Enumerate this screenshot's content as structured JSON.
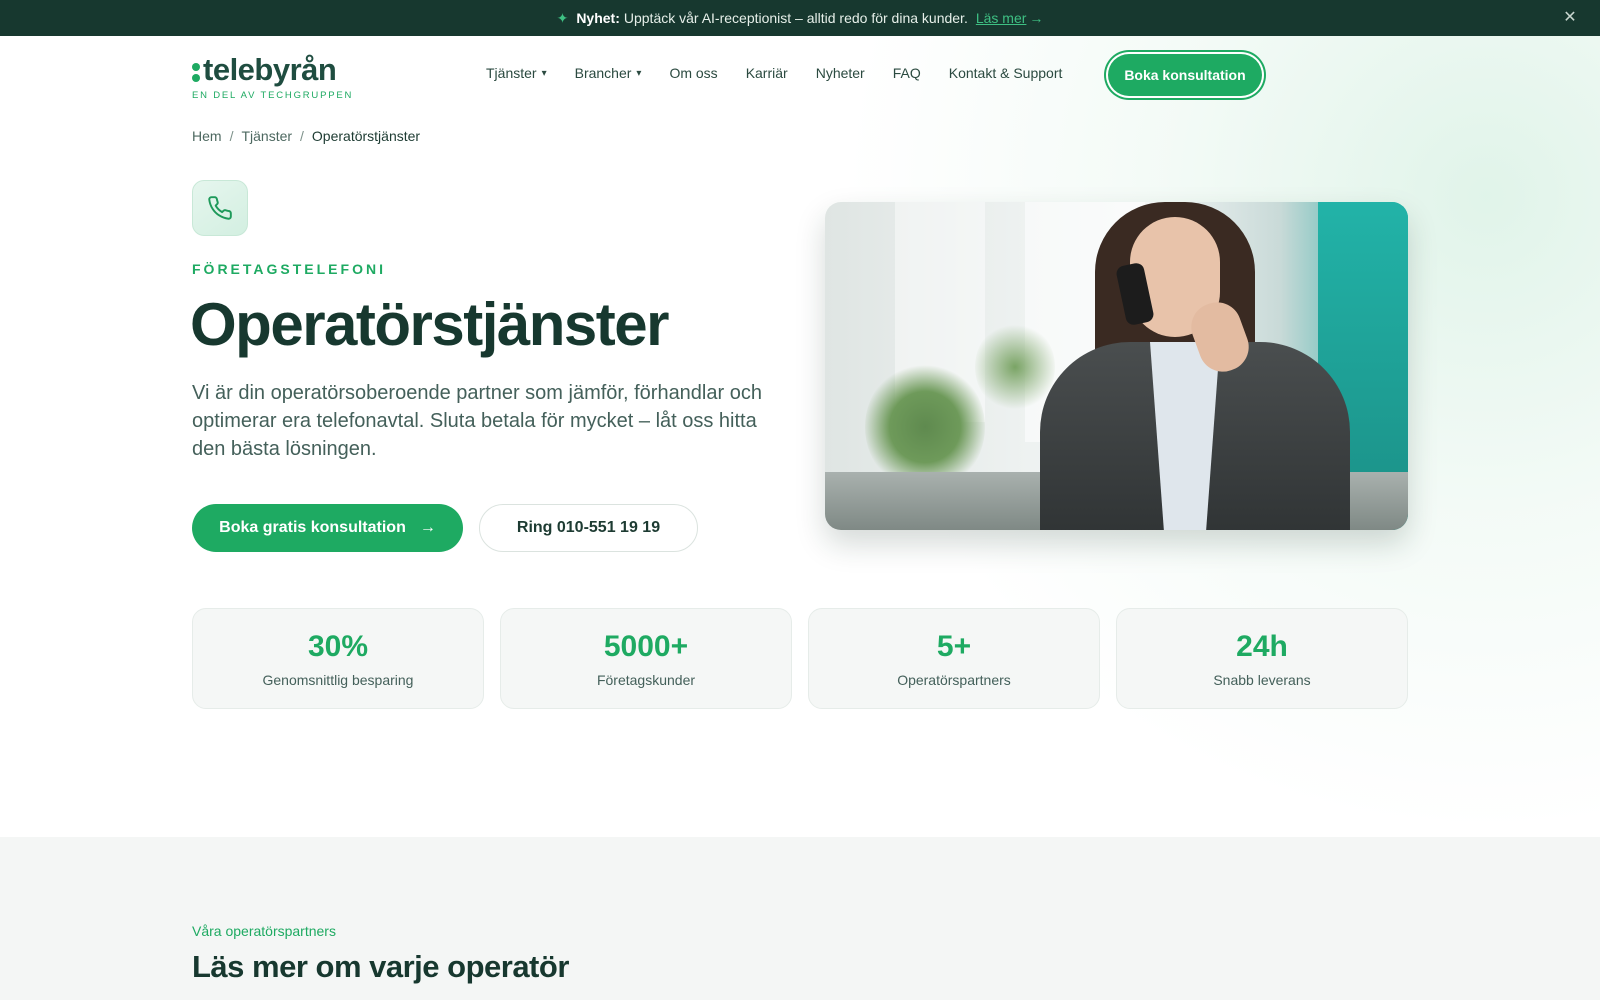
{
  "announcement": {
    "label": "Nyhet:",
    "text": "Upptäck vår AI-receptionist – alltid redo för dina kunder.",
    "link": "Läs mer"
  },
  "brand": {
    "name": "telebyrån",
    "tagline": "EN DEL AV TECHGRUPPEN",
    "accent": "#1eaa62",
    "dark": "#17382f"
  },
  "nav": {
    "items": [
      {
        "label": "Tjänster",
        "dropdown": true
      },
      {
        "label": "Brancher",
        "dropdown": true
      },
      {
        "label": "Om oss",
        "dropdown": false
      },
      {
        "label": "Karriär",
        "dropdown": false
      },
      {
        "label": "Nyheter",
        "dropdown": false
      },
      {
        "label": "FAQ",
        "dropdown": false
      },
      {
        "label": "Kontakt & Support",
        "dropdown": false
      }
    ],
    "cta": "Boka konsultation"
  },
  "breadcrumb": [
    "Hem",
    "Tjänster",
    "Operatörstjänster"
  ],
  "hero": {
    "eyebrow": "FÖRETAGSTELEFONI",
    "title": "Operatörstjänster",
    "description": "Vi är din operatörsoberoende partner som jämför, förhandlar och optimerar era telefonavtal. Sluta betala för mycket – låt oss hitta den bästa lösningen.",
    "primary_button": "Boka gratis konsultation",
    "secondary_button": "Ring 010-551 19 19",
    "icon": "phone-icon"
  },
  "stats": [
    {
      "value": "30%",
      "label": "Genomsnittlig besparing"
    },
    {
      "value": "5000+",
      "label": "Företagskunder"
    },
    {
      "value": "5+",
      "label": "Operatörspartners"
    },
    {
      "value": "24h",
      "label": "Snabb leverans"
    }
  ],
  "partners": {
    "eyebrow": "Våra operatörspartners",
    "title": "Läs mer om varje operatör"
  }
}
